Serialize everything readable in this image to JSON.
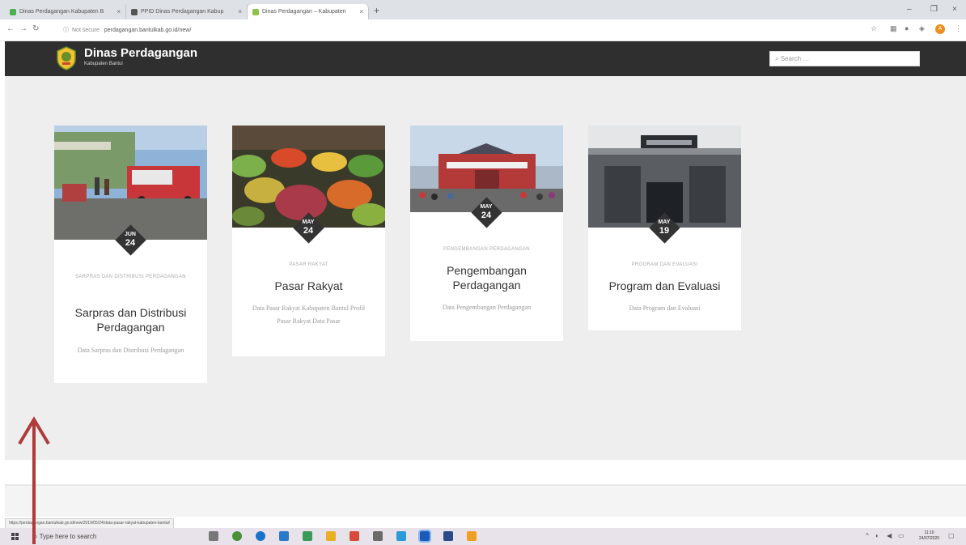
{
  "browser": {
    "tabs": [
      {
        "title": "Dinas Perdagangan Kabupaten B",
        "active": false,
        "favicon_color": "#4caf50"
      },
      {
        "title": "PPID Dinas Perdagangan Kabup",
        "active": false,
        "favicon_color": "#555555"
      },
      {
        "title": "Dinas Perdagangan – Kabupaten",
        "active": true,
        "favicon_color": "#8bc34a"
      }
    ],
    "new_tab": "+",
    "security_label": "Not secure",
    "url": "perdagangan.bantulkab.go.id/new/",
    "window_controls": [
      "–",
      "❐",
      "×"
    ],
    "profile_initial": "A"
  },
  "site": {
    "title": "Dinas Perdagangan",
    "subtitle": "Kabupaten Bantul",
    "search_placeholder": "Search …"
  },
  "posts": [
    {
      "month": "JUN",
      "day": "24",
      "category": "SARPRAS DAN DISTRIBUSI PERDAGANGAN",
      "title": "Sarpras dan Distribusi Perdagangan",
      "excerpt": "Data Sarpras dan Distribusi Perdagangan",
      "image_desc": "truck-at-market"
    },
    {
      "month": "MAY",
      "day": "24",
      "category": "PASAR RAKYAT",
      "title": "Pasar Rakyat",
      "excerpt": "Data Pasar Rakyat Kabupaten Bantul Profil Pasar Rakyat Data Pasar",
      "image_desc": "vegetable-stall"
    },
    {
      "month": "MAY",
      "day": "24",
      "category": "PENGEMBANGAN PERDAGANGAN",
      "title": "Pengembangan Perdagangan",
      "excerpt": "Data Pengembangan Perdagangan",
      "image_desc": "market-building"
    },
    {
      "month": "MAY",
      "day": "19",
      "category": "PROGRAM DAN EVALUASI",
      "title": "Program dan Evaluasi",
      "excerpt": "Data Program dan Evaluasi",
      "image_desc": "office-entrance"
    }
  ],
  "status_bar_url": "https://perdagangan.bantulkab.go.id/new/2019/05/24/data-pasar-rakyat-kabupaten-bantul/",
  "taskbar": {
    "search_placeholder": "Type here to search",
    "time": "11:10",
    "date": "24/07/2020"
  },
  "colors": {
    "header_bg": "#2f2f2f",
    "content_bg": "#eeeeee",
    "badge_bg": "#333333",
    "annotation_arrow": "#b03a3a"
  }
}
